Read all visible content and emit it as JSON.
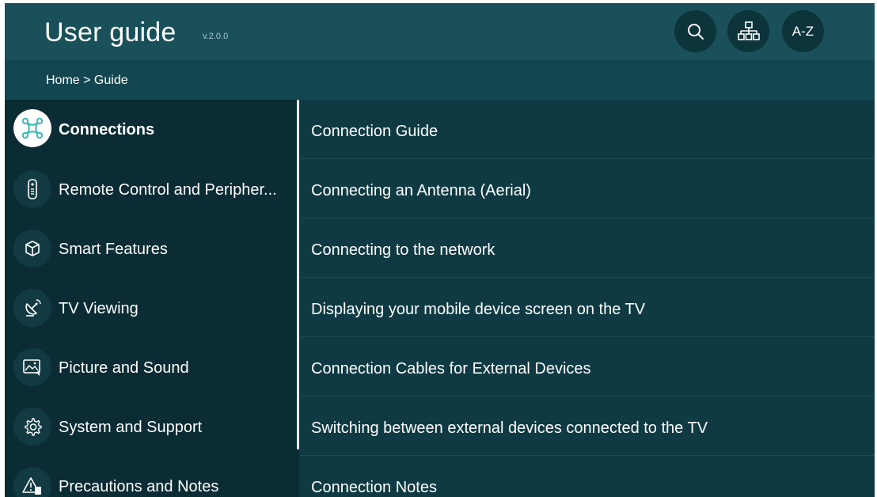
{
  "header": {
    "title": "User guide",
    "version": "v.2.0.0",
    "search_icon": "search-icon",
    "sitemap_icon": "sitemap-icon",
    "az_label": "A-Z"
  },
  "breadcrumb": "Home > Guide",
  "sidebar": {
    "items": [
      {
        "label": "Connections",
        "icon": "connections-icon",
        "selected": true
      },
      {
        "label": "Remote Control and Peripher...",
        "icon": "remote-icon",
        "selected": false
      },
      {
        "label": "Smart Features",
        "icon": "cube-icon",
        "selected": false
      },
      {
        "label": "TV Viewing",
        "icon": "satellite-icon",
        "selected": false
      },
      {
        "label": "Picture and Sound",
        "icon": "picture-sound-icon",
        "selected": false
      },
      {
        "label": "System and Support",
        "icon": "gear-icon",
        "selected": false
      },
      {
        "label": "Precautions and Notes",
        "icon": "warning-icon",
        "selected": false
      }
    ]
  },
  "content": {
    "items": [
      "Connection Guide",
      "Connecting an Antenna (Aerial)",
      "Connecting to the network",
      "Displaying your mobile device screen on the TV",
      "Connection Cables for External Devices",
      "Switching between external devices connected to the TV",
      "Connection Notes"
    ]
  },
  "colors": {
    "header_bg": "#19505a",
    "breadcrumb_bg": "#134650",
    "sidebar_bg": "#0b2c34",
    "content_bg": "#0f3a43",
    "accent": "#3fb8b0"
  }
}
